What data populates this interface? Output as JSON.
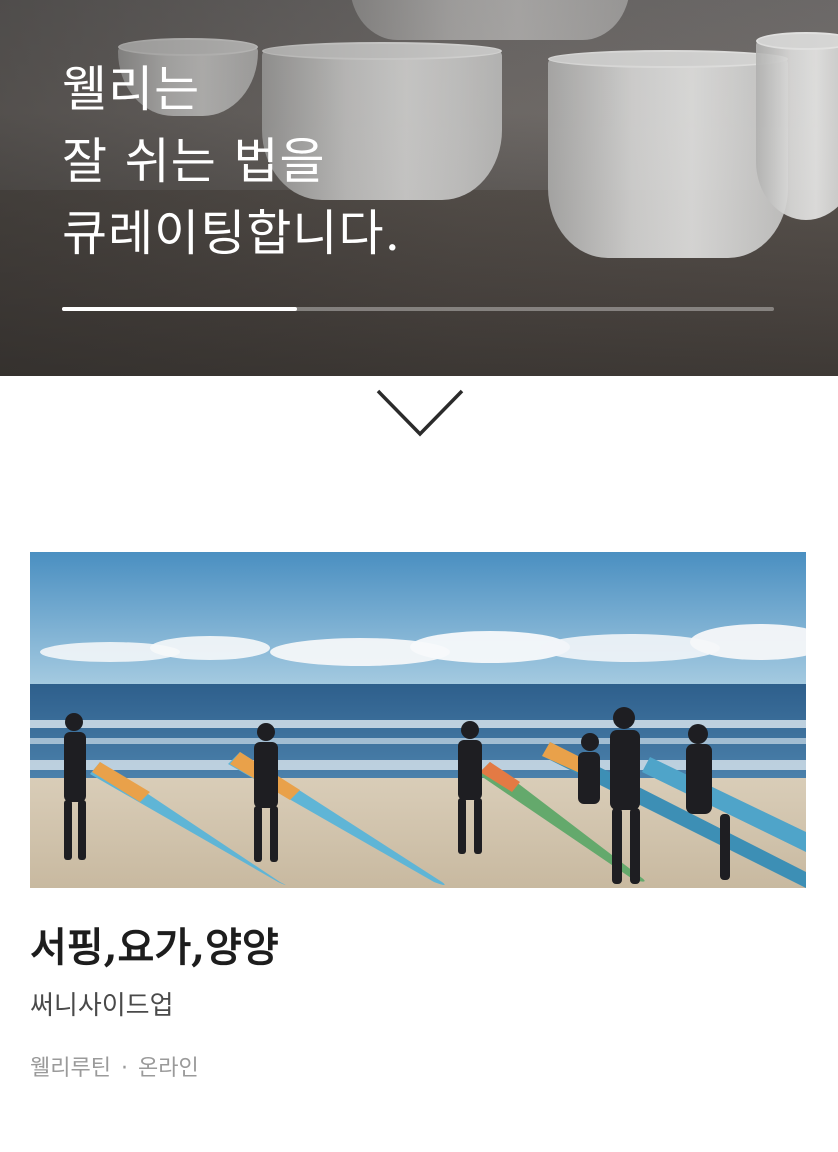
{
  "hero": {
    "title_lines": [
      "웰리는",
      "잘 쉬는 법을",
      "큐레이팅합니다."
    ],
    "progress": 0.33,
    "background_image": "singing-bowls-photo"
  },
  "scroll_down": {
    "icon": "chevron-down-icon"
  },
  "card": {
    "image": "surfers-on-beach-photo",
    "title": "서핑,요가,양양",
    "subtitle": "써니사이드업",
    "category": "웰리루틴",
    "separator": "·",
    "type": "온라인"
  },
  "colors": {
    "title_text": "#1d1d1d",
    "subtitle_text": "#4a4a4a",
    "meta_text": "#9a9a9a",
    "hero_text": "#ffffff"
  }
}
